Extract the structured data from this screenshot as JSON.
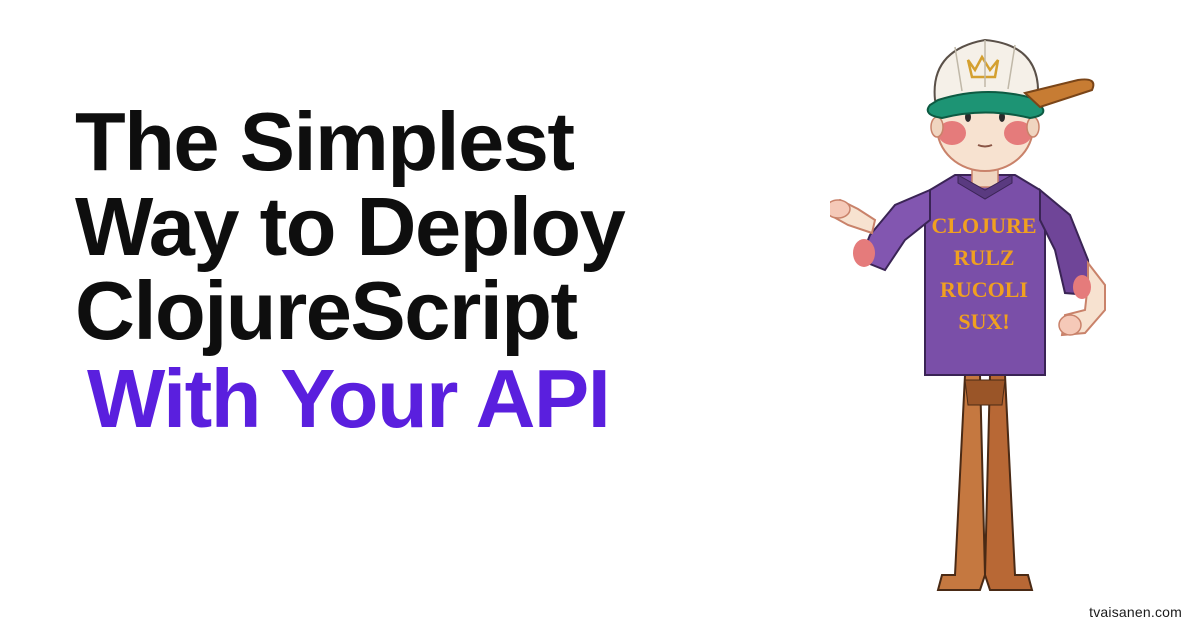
{
  "headline": {
    "line1": "The Simplest",
    "line2": "Way to Deploy",
    "line3": "ClojureScript",
    "accent": "With Your API"
  },
  "character": {
    "shirt": {
      "line1": "CLOJURE",
      "line2": "RULZ",
      "line3": "RUCOLI",
      "line4": "SUX!"
    }
  },
  "attribution": "tvaisanen.com",
  "colors": {
    "text_primary": "#0e0e0e",
    "text_accent": "#5a1fde",
    "shirt_purple": "#7a4fa8",
    "shirt_text": "#f0a020",
    "cap_top": "#1d9474",
    "cap_brim": "#c77c33",
    "skin": "#f7e2d0",
    "cheek": "#e57b7b",
    "pants": "#c57840"
  }
}
